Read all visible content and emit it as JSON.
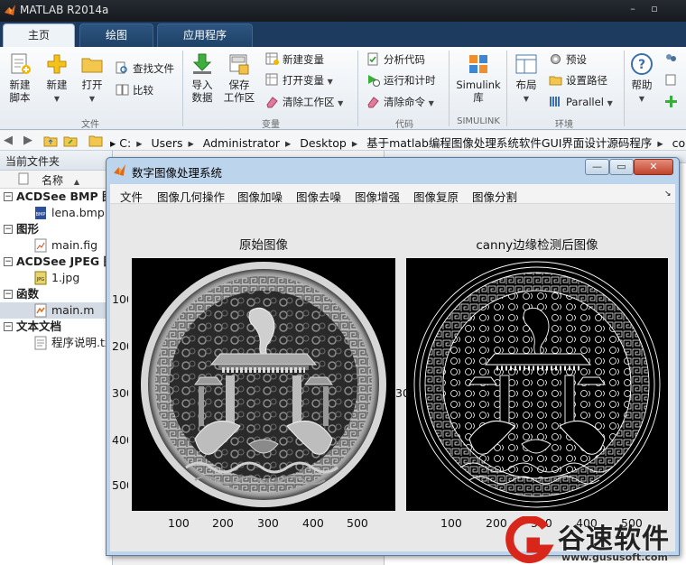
{
  "app": {
    "title": "MATLAB R2014a"
  },
  "ribbon": {
    "tabs": [
      "主页",
      "绘图",
      "应用程序"
    ],
    "file_group": {
      "label": "文件",
      "new_script": "新建\n脚本",
      "new": "新建",
      "open": "打开",
      "find_files": "查找文件",
      "compare": "比较"
    },
    "variable_group": {
      "label": "变量",
      "import_data": "导入\n数据",
      "save_workspace": "保存\n工作区",
      "new_variable": "新建变量",
      "open_variable": "打开变量",
      "clear_workspace": "清除工作区"
    },
    "code_group": {
      "label": "代码",
      "analyze_code": "分析代码",
      "run_and_time": "运行和计时",
      "clear_commands": "清除命令"
    },
    "simulink_group": {
      "label": "SIMULINK",
      "simulink": "Simulink\n库"
    },
    "env_group": {
      "label": "环境",
      "layout": "布局",
      "preferences": "预设",
      "set_path": "设置路径",
      "parallel": "Parallel"
    },
    "resources_group": {
      "help": "帮助"
    }
  },
  "address": {
    "crumbs": [
      "C:",
      "Users",
      "Administrator",
      "Desktop",
      "基于matlab编程图像处理系统软件GUI界面设计源码程序",
      "code"
    ]
  },
  "filepanel": {
    "title": "当前文件夹",
    "column_header": "名称",
    "groups": [
      {
        "label": "ACDSee BMP 图",
        "files": [
          "lena.bmp"
        ]
      },
      {
        "label": "图形",
        "files": [
          "main.fig"
        ]
      },
      {
        "label": "ACDSee JPEG 图",
        "files": [
          "1.jpg"
        ]
      },
      {
        "label": "函数",
        "files": [
          "main.m"
        ]
      },
      {
        "label": "文本文档",
        "files": [
          "程序说明.tx"
        ]
      }
    ]
  },
  "figure": {
    "title": "数字图像处理系统",
    "menu": [
      "文件",
      "图像几何操作",
      "图像加噪",
      "图像去噪",
      "图像增强",
      "图像复原",
      "图像分割"
    ],
    "axes_left": {
      "title": "原始图像",
      "xticks": [
        "100",
        "200",
        "300",
        "400",
        "500"
      ],
      "yticks": [
        "100",
        "200",
        "300",
        "400",
        "500"
      ]
    },
    "axes_right": {
      "title": "canny边缘检测后图像",
      "xticks": [
        "100",
        "200",
        "300",
        "400",
        "500"
      ],
      "yticks": [
        "300"
      ]
    }
  },
  "watermark": {
    "brand": "谷速软件",
    "url": "www.gususoft.com"
  },
  "colors": {
    "matlab_titlebar": "#1b1f24",
    "ribbon_tabbar": "#1d3b5e",
    "figure_frame": "#bcd4ec",
    "watermark_red": "#d8261b"
  }
}
